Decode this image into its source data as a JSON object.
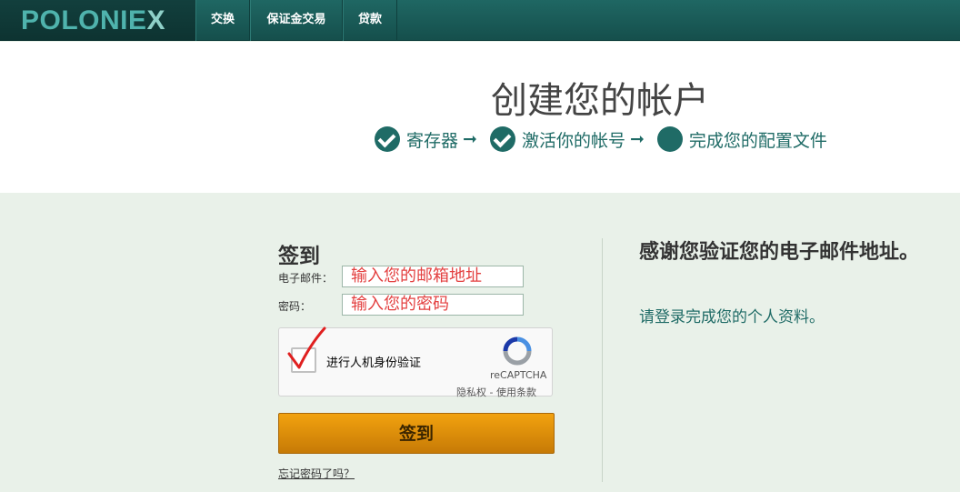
{
  "brand": {
    "logo_main": "POLONIE",
    "logo_x": "X"
  },
  "nav": {
    "items": [
      {
        "label": "交换"
      },
      {
        "label": "保证金交易"
      },
      {
        "label": "贷款"
      }
    ]
  },
  "header": {
    "title": "创建您的帐户",
    "steps": [
      {
        "label": "寄存器",
        "state": "done"
      },
      {
        "label": "激活你的帐号",
        "state": "done"
      },
      {
        "label": "完成您的配置文件",
        "state": "current"
      }
    ],
    "arrow": "➞"
  },
  "signin": {
    "title": "签到",
    "email_label": "电子邮件：",
    "email_value": "输入您的邮箱地址",
    "password_label": "密码：",
    "password_value": "输入您的密码",
    "captcha": {
      "text": "进行人机身份验证",
      "brand": "reCAPTCHA",
      "links": "隐私权 - 使用条款"
    },
    "submit_label": "签到",
    "forgot_label": "忘记密码了吗？"
  },
  "right": {
    "title": "感谢您验证您的电子邮件地址。",
    "text": "请登录完成您的个人资料。"
  },
  "colors": {
    "accent": "#1f6b66",
    "nav_bg": "#1a5c59",
    "button": "#e39109",
    "annotation": "#e34040"
  }
}
